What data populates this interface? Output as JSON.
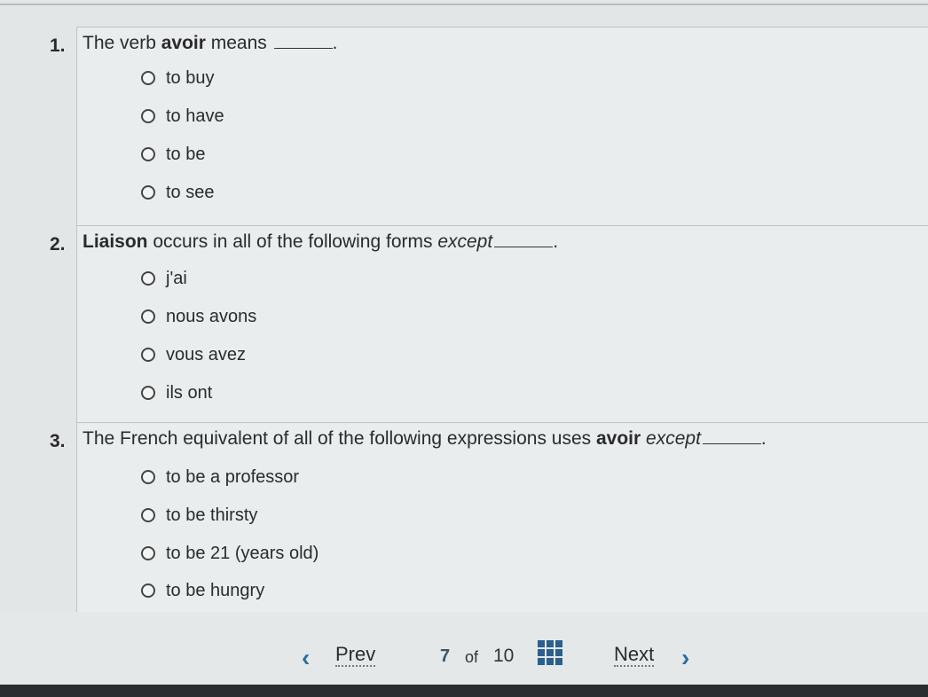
{
  "questions": [
    {
      "number": "1.",
      "stem_parts": {
        "before": "The verb ",
        "bold": "avoir",
        "after": " means ",
        "italic": ""
      },
      "options": [
        "to buy",
        "to have",
        "to be",
        "to see"
      ]
    },
    {
      "number": "2.",
      "stem_parts": {
        "before": "",
        "bold": "Liaison",
        "after": " occurs in all of the following forms ",
        "italic": "except"
      },
      "options": [
        "j'ai",
        "nous avons",
        "vous avez",
        "ils ont"
      ]
    },
    {
      "number": "3.",
      "stem_parts": {
        "before": "The French equivalent of all of the following expressions uses ",
        "bold": "avoir",
        "after": " ",
        "italic": "except"
      },
      "options": [
        "to be a professor",
        "to be thirsty",
        "to be 21 (years old)",
        "to be hungry"
      ]
    }
  ],
  "nav": {
    "prev_label": "Prev",
    "next_label": "Next",
    "current_page": "7",
    "of_label": "of",
    "total_pages": "10",
    "prev_icon": "chevron-left",
    "next_icon": "chevron-right",
    "grid_icon": "grid-9"
  },
  "colors": {
    "accent": "#2e6f9e",
    "grid_icon": "#2a5f8e"
  }
}
